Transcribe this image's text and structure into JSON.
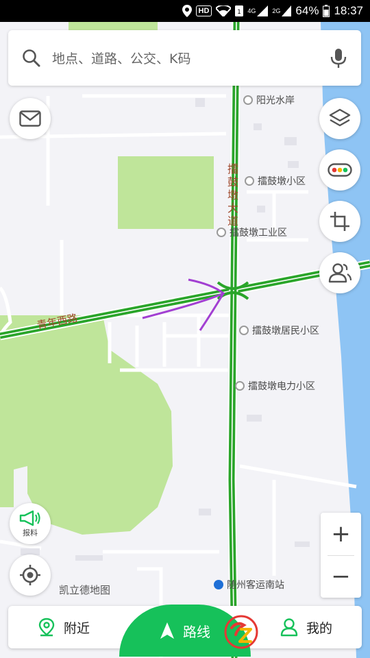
{
  "status_bar": {
    "hd": "HD",
    "signal_4g": "4G",
    "signal_2g": "2G",
    "battery": "64%",
    "time": "18:37"
  },
  "search": {
    "placeholder": "地点、道路、公交、K码"
  },
  "map": {
    "road_horizontal": "青年西路",
    "road_vertical": "擂鼓墩大道",
    "pois": {
      "p1": "阳光水岸",
      "p2": "擂鼓墩小区",
      "p3": "擂鼓墩工业区",
      "p4": "擂鼓墩居民小区",
      "p5": "擂鼓墩电力小区",
      "p6": "随州客运南站"
    },
    "watermark": "凯立德地图"
  },
  "controls": {
    "report_label": "报料",
    "zoom_in": "+",
    "zoom_out": "−"
  },
  "bottom_nav": {
    "nearby": "附近",
    "route": "路线",
    "mine": "我的"
  },
  "colors": {
    "accent_green": "#16c15a",
    "road_green": "#2aa52a",
    "park_green": "#bfe59a",
    "water_blue": "#8ec4f4"
  }
}
